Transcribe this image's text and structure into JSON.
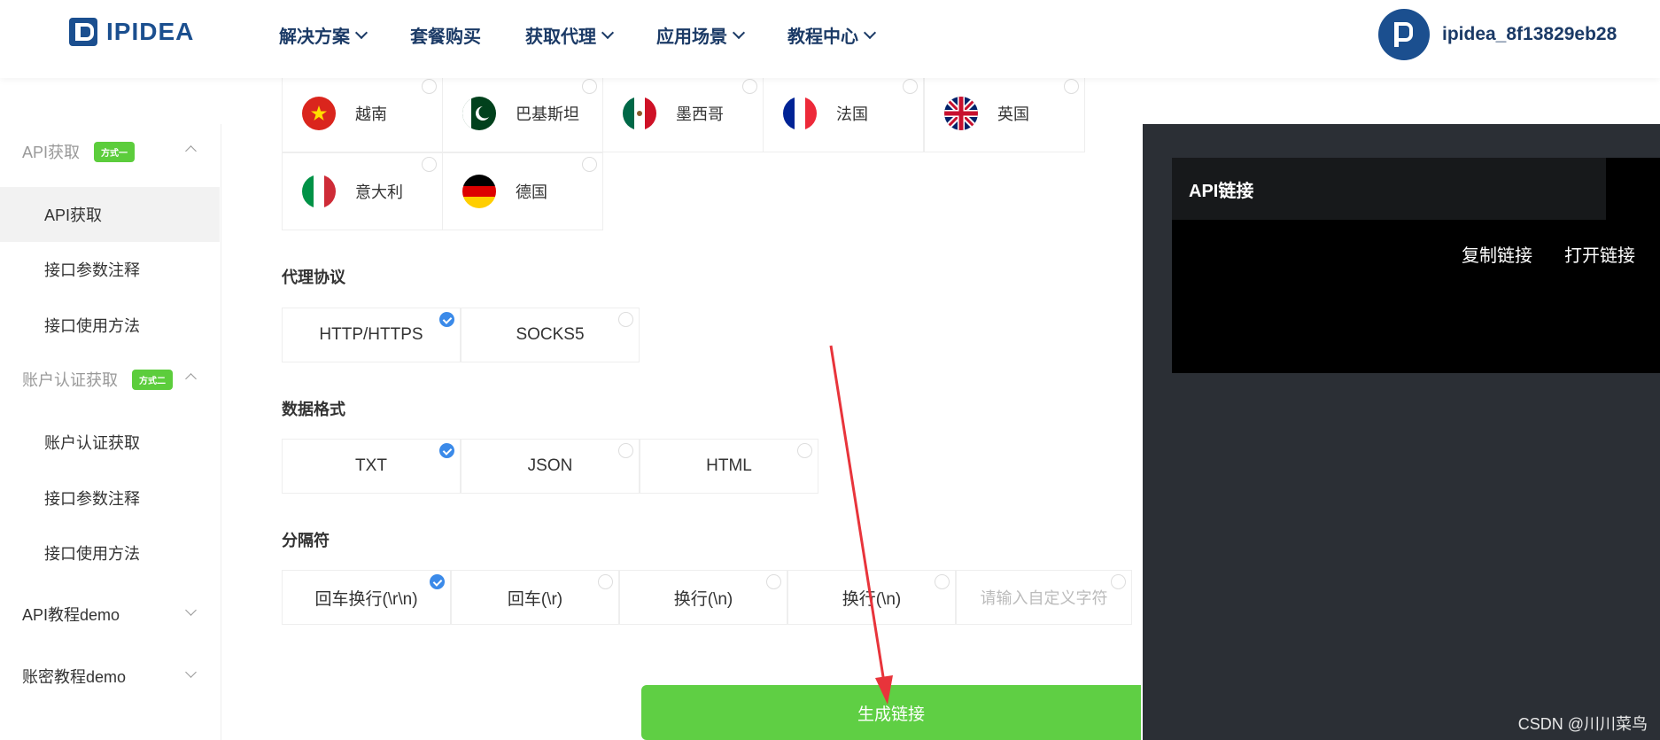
{
  "header": {
    "logo_text": "IPIDEA",
    "nav": [
      {
        "label": "解决方案",
        "has_dropdown": true
      },
      {
        "label": "套餐购买",
        "has_dropdown": false
      },
      {
        "label": "获取代理",
        "has_dropdown": true
      },
      {
        "label": "应用场景",
        "has_dropdown": true
      },
      {
        "label": "教程中心",
        "has_dropdown": true
      }
    ],
    "username": "ipidea_8f13829eb28"
  },
  "sidebar": {
    "group1": {
      "label": "API获取",
      "badge": "方式一"
    },
    "group1_items": [
      "API获取",
      "接口参数注释",
      "接口使用方法"
    ],
    "group2": {
      "label": "账户认证获取",
      "badge": "方式二"
    },
    "group2_items": [
      "账户认证获取",
      "接口参数注释",
      "接口使用方法"
    ],
    "group3": {
      "label": "API教程demo"
    },
    "group4": {
      "label": "账密教程demo"
    }
  },
  "countries": [
    {
      "name": "越南",
      "flag": "vietnam-flag-icon"
    },
    {
      "name": "巴基斯坦",
      "flag": "pakistan-flag-icon"
    },
    {
      "name": "墨西哥",
      "flag": "mexico-flag-icon"
    },
    {
      "name": "法国",
      "flag": "france-flag-icon"
    },
    {
      "name": "英国",
      "flag": "uk-flag-icon"
    },
    {
      "name": "意大利",
      "flag": "italy-flag-icon"
    },
    {
      "name": "德国",
      "flag": "germany-flag-icon"
    }
  ],
  "protocol": {
    "title": "代理协议",
    "options": [
      "HTTP/HTTPS",
      "SOCKS5"
    ],
    "selected": "HTTP/HTTPS"
  },
  "format": {
    "title": "数据格式",
    "options": [
      "TXT",
      "JSON",
      "HTML"
    ],
    "selected": "TXT"
  },
  "separator": {
    "title": "分隔符",
    "options": [
      "回车换行(\\r\\n)",
      "回车(\\r)",
      "换行(\\n)",
      "换行(\\n)"
    ],
    "custom_placeholder": "请输入自定义字符",
    "selected": "回车换行(\\r\\n)"
  },
  "generate_button": "生成链接",
  "panel": {
    "title": "API链接",
    "copy_label": "复制链接",
    "open_label": "打开链接"
  },
  "watermark": "CSDN @川川菜鸟",
  "colors": {
    "brand": "#1b4f8f",
    "green": "#5fcf44",
    "check_blue": "#3b8ae9",
    "panel_bg": "#2b2f35",
    "arrow": "#e8343b"
  }
}
